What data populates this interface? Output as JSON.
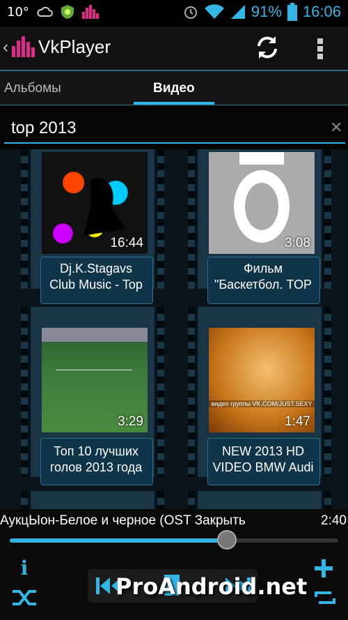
{
  "status_bar": {
    "temperature": "10°",
    "battery": "91%",
    "time": "16:06",
    "icons": [
      "cloud-icon",
      "android-shield-icon",
      "equalizer-icon",
      "alarm-icon",
      "wifi-icon",
      "signal-icon",
      "battery-icon"
    ]
  },
  "action_bar": {
    "app_name": "VkPlayer",
    "icons": [
      "back-chevron-icon",
      "app-logo-icon",
      "refresh-icon",
      "overflow-menu-icon"
    ]
  },
  "tabs": [
    {
      "label": "Альбомы",
      "active": false
    },
    {
      "label": "Видео",
      "active": true
    }
  ],
  "search": {
    "value": "top 2013"
  },
  "videos": [
    {
      "title_line1": "Dj.K.Stagavs",
      "title_line2": "Club Music - Top",
      "duration": "16:44"
    },
    {
      "title_line1": "Фильм",
      "title_line2": "\"Баскетбол. TOP",
      "duration": "3:08"
    },
    {
      "title_line1": "Топ 10 лучших",
      "title_line2": "голов 2013 года",
      "duration": "3:29"
    },
    {
      "title_line1": "NEW 2013 HD",
      "title_line2": "VIDEO BMW Audi",
      "duration": "1:47"
    }
  ],
  "thumb_overlay_text": "видео группы VK.COM/JUST.SEXY",
  "player": {
    "track_title": "АукцЫон-Белое и черное (OST Закрыть",
    "elapsed": "2:40",
    "progress": 0.66,
    "icons": [
      "info-icon",
      "shuffle-icon",
      "previous-icon",
      "play-icon",
      "next-icon",
      "add-icon",
      "repeat-icon"
    ]
  },
  "watermark": "ProAndroid.net",
  "colors": {
    "accent": "#33b5e5",
    "film": "#1a3545"
  }
}
